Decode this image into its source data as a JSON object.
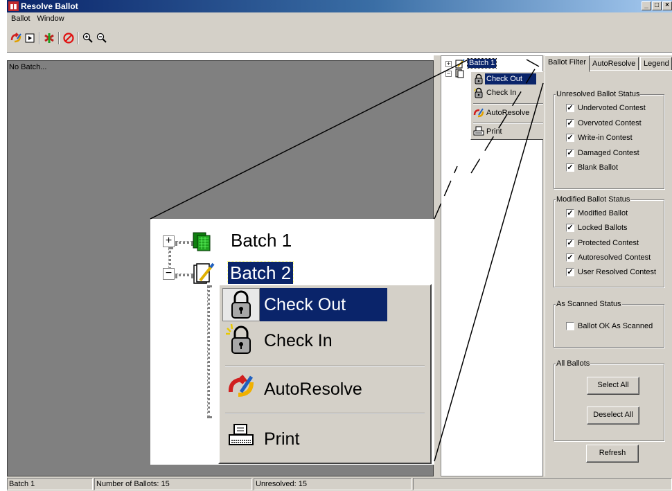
{
  "window": {
    "title": "Resolve Ballot",
    "minimize": "_",
    "maximize": "□",
    "close": "×"
  },
  "menu": [
    "Ballot",
    "Window"
  ],
  "toolbar": {
    "icons": [
      "autoresolve-icon",
      "play-icon",
      "resolve-icon",
      "stop-icon",
      "zoom-in-icon",
      "zoom-out-icon"
    ]
  },
  "main": {
    "placeholder": "No Batch..."
  },
  "tree": {
    "batches": [
      {
        "label": "Batch 1",
        "expander": "+"
      },
      {
        "label": "Batch 2",
        "expander": "−"
      }
    ]
  },
  "context_menu": {
    "items": [
      {
        "label": "Check Out",
        "selected": true,
        "icon": "lock-icon"
      },
      {
        "label": "Check In",
        "selected": false,
        "icon": "unlock-icon"
      },
      {
        "label": "AutoResolve",
        "selected": false,
        "icon": "autoresolve-icon"
      },
      {
        "label": "Print",
        "selected": false,
        "icon": "printer-icon"
      }
    ]
  },
  "tabs": [
    "Ballot Filter",
    "AutoResolve",
    "Legend"
  ],
  "filter": {
    "unresolved": {
      "title": "Unresolved Ballot Status",
      "items": [
        {
          "label": "Undervoted Contest",
          "checked": true
        },
        {
          "label": "Overvoted Contest",
          "checked": true
        },
        {
          "label": "Write-in Contest",
          "checked": true
        },
        {
          "label": "Damaged Contest",
          "checked": true
        },
        {
          "label": "Blank Ballot",
          "checked": true
        }
      ]
    },
    "modified": {
      "title": "Modified Ballot Status",
      "items": [
        {
          "label": "Modified Ballot",
          "checked": true
        },
        {
          "label": "Locked Ballots",
          "checked": true
        },
        {
          "label": "Protected Contest",
          "checked": true
        },
        {
          "label": "Autoresolved Contest",
          "checked": true
        },
        {
          "label": "User Resolved Contest",
          "checked": true
        }
      ]
    },
    "scanned": {
      "title": "As Scanned Status",
      "items": [
        {
          "label": "Ballot OK As Scanned",
          "checked": false
        }
      ]
    },
    "all": {
      "title": "All Ballots",
      "select_all": "Select All",
      "deselect_all": "Deselect All"
    },
    "refresh": "Refresh"
  },
  "status": {
    "batch": "Batch 1",
    "count": "Number of Ballots: 15",
    "unresolved": "Unresolved: 15"
  },
  "colors": {
    "selection": "#0a246a",
    "face": "#d4d0c8",
    "workspace": "#808080"
  }
}
